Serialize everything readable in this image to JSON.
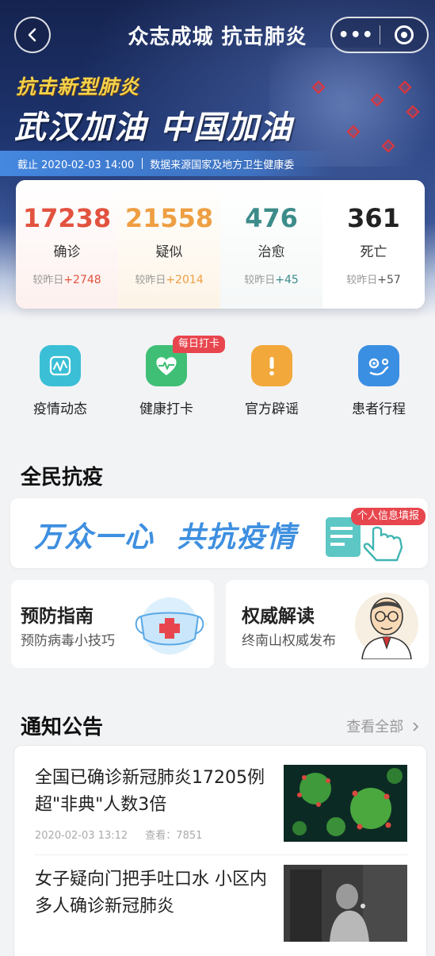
{
  "nav": {
    "title": "众志成城  抗击肺炎",
    "more_label": "•••"
  },
  "hero": {
    "slogan_small": "抗击新型肺炎",
    "slogan_big": "武汉加油 中国加油",
    "as_of": "截止 2020-02-03 14:00",
    "source": "数据来源国家及地方卫生健康委"
  },
  "stats": [
    {
      "value": "17238",
      "label": "确诊",
      "delta_prefix": "较昨日",
      "delta": "+2748",
      "color": "#e2533f",
      "delta_color": "#e2533f"
    },
    {
      "value": "21558",
      "label": "疑似",
      "delta_prefix": "较昨日",
      "delta": "+2014",
      "color": "#ee9f43",
      "delta_color": "#ee9f43"
    },
    {
      "value": "476",
      "label": "治愈",
      "delta_prefix": "较昨日",
      "delta": "+45",
      "color": "#3c8c8a",
      "delta_color": "#3c8c8a"
    },
    {
      "value": "361",
      "label": "死亡",
      "delta_prefix": "较昨日",
      "delta": "+57",
      "color": "#222222",
      "delta_color": "#555555"
    }
  ],
  "quick": [
    {
      "label": "疫情动态",
      "icon": "chart-icon",
      "color": "#3bbfd6"
    },
    {
      "label": "健康打卡",
      "icon": "heart-pulse-icon",
      "color": "#3fbf76",
      "badge": "每日打卡"
    },
    {
      "label": "官方辟谣",
      "icon": "exclamation-icon",
      "color": "#f2a83b"
    },
    {
      "label": "患者行程",
      "icon": "route-icon",
      "color": "#3b8fe3"
    }
  ],
  "sections": {
    "all_people": "全民抗疫",
    "notices": "通知公告",
    "view_all": "查看全部"
  },
  "banner": {
    "left": "万众一心",
    "right": "共抗疫情",
    "tag": "个人信息填报"
  },
  "cards": [
    {
      "title": "预防指南",
      "subtitle": "预防病毒小技巧"
    },
    {
      "title": "权威解读",
      "subtitle": "终南山权威发布"
    }
  ],
  "news": [
    {
      "title": "全国已确诊新冠肺炎17205例 超\"非典\"人数3倍",
      "date": "2020-02-03 13:12",
      "views": "查看：7851"
    },
    {
      "title": "女子疑向门把手吐口水 小区内多人确诊新冠肺炎"
    }
  ]
}
